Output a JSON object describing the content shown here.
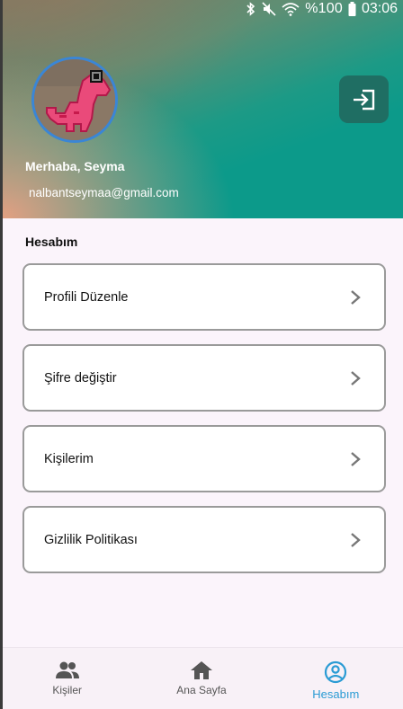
{
  "status_bar": {
    "battery": "%100",
    "time": "03:06",
    "icons": [
      "bluetooth-icon",
      "mute-icon",
      "wifi-icon",
      "battery-icon"
    ]
  },
  "profile": {
    "greeting": "Merhaba, Seyma",
    "email": "nalbantseymaa@gmail.com",
    "avatar_icon": "pink-dinosaur-pixel-art"
  },
  "actions": {
    "logout_icon": "logout-icon"
  },
  "section": {
    "title": "Hesabım"
  },
  "menu": [
    {
      "label": "Profili Düzenle"
    },
    {
      "label": "Şifre değiştir"
    },
    {
      "label": "Kişilerim"
    },
    {
      "label": "Gizlilik Politikası"
    }
  ],
  "bottom_nav": [
    {
      "label": "Kişiler",
      "icon": "people-icon",
      "active": false
    },
    {
      "label": "Ana Sayfa",
      "icon": "home-icon",
      "active": false
    },
    {
      "label": "Hesabım",
      "icon": "account-circle-icon",
      "active": true
    }
  ],
  "colors": {
    "accent": "#2a9bd4",
    "logout_bg": "#1f6e63",
    "avatar_border": "#3a86d6"
  }
}
